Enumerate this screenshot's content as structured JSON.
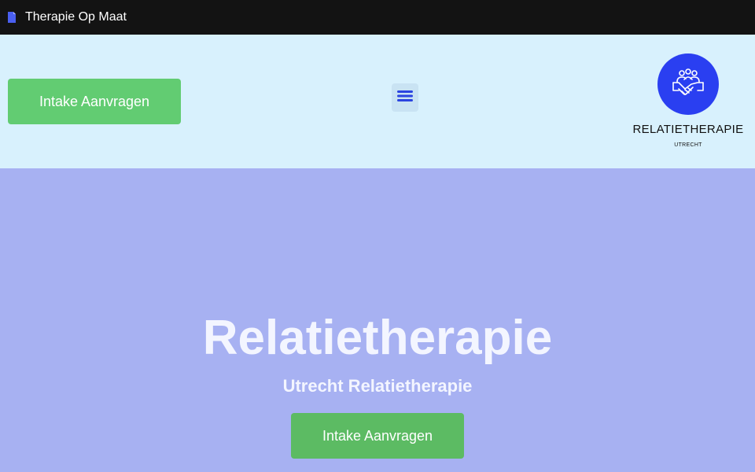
{
  "browser": {
    "tab_title": "Therapie Op Maat",
    "tab_icon": "document-icon"
  },
  "header": {
    "cta_label": "Intake Aanvragen",
    "menu_icon": "hamburger-menu-icon",
    "logo": {
      "icon": "handshake-people-icon",
      "name": "RELATIETHERAPIE",
      "sub": "UTRECHT"
    }
  },
  "hero": {
    "title": "Relatietherapie",
    "subtitle": "Utrecht Relatietherapie",
    "cta_label": "Intake Aanvragen"
  },
  "colors": {
    "tabbar": "#131313",
    "header_bg": "#d8f1fd",
    "hero_bg": "#a7b1f2",
    "cta_green": "#62cc72",
    "logo_blue": "#2a3ff1",
    "menu_icon": "#2b44e0"
  }
}
